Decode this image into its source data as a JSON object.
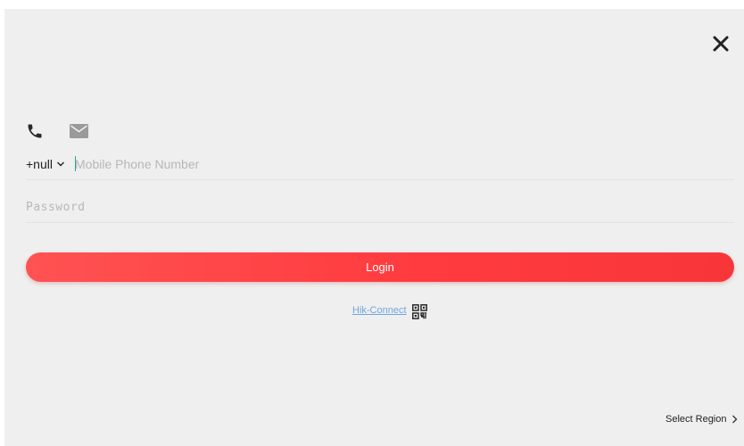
{
  "login": {
    "country_code": "+null",
    "phone_placeholder": "Mobile Phone Number",
    "password_placeholder": "Password",
    "login_label": "Login",
    "hik_connect_label": "Hik-Connect",
    "select_region_label": "Select Region"
  },
  "icons": {
    "close": "close-icon",
    "phone_mode": "phone-icon",
    "email_mode": "envelope-icon",
    "country_dropdown": "chevron-down-icon",
    "qr": "qr-code-icon",
    "region_arrow": "chevron-right-icon"
  },
  "colors": {
    "background": "#efefef",
    "accent": "#ff3b3f",
    "link": "#6fa6de",
    "caret": "#2aa39a"
  }
}
